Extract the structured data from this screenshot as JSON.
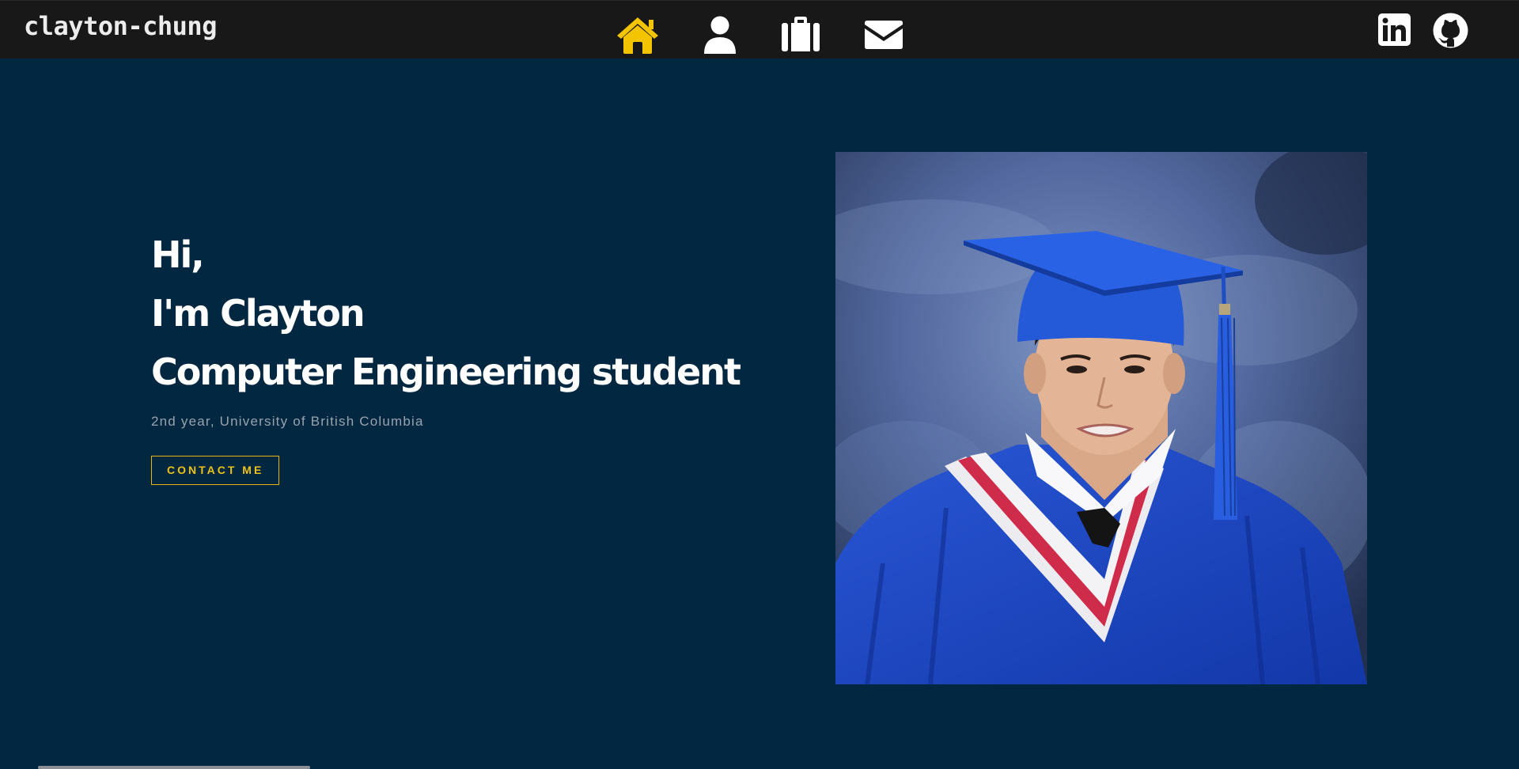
{
  "header": {
    "brand": "clayton-chung",
    "nav": [
      {
        "icon": "home-icon",
        "active": true
      },
      {
        "icon": "user-icon",
        "active": false
      },
      {
        "icon": "briefcase-icon",
        "active": false
      },
      {
        "icon": "envelope-icon",
        "active": false
      }
    ],
    "social": [
      {
        "icon": "linkedin-icon"
      },
      {
        "icon": "github-icon"
      }
    ]
  },
  "hero": {
    "line1": "Hi,",
    "line2": "I'm Clayton",
    "line3": "Computer Engineering student",
    "subtitle": "2nd year, University of British Columbia",
    "cta_label": "CONTACT ME"
  },
  "colors": {
    "background": "#022741",
    "topbar": "#181818",
    "accent": "#f5c400",
    "text": "#ffffff",
    "muted": "#9aa3ad"
  }
}
